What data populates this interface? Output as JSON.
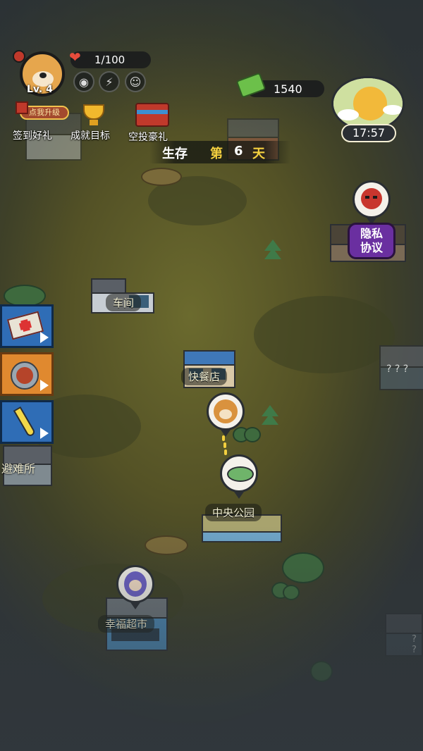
{
  "player": {
    "level": "Lv. 4",
    "health": "1/100",
    "money": "1540",
    "avatar_icon": "dog-avatar"
  },
  "top_menu": [
    {
      "label": "签到好礼",
      "badge": "点我升级",
      "icon": "gift-icon"
    },
    {
      "label": "成就目标",
      "icon": "trophy-icon"
    },
    {
      "label": "空投豪礼",
      "icon": "airdrop-crate-icon"
    }
  ],
  "survival": {
    "prefix": "生存",
    "day_word": "第",
    "day": "6",
    "suffix": "天"
  },
  "clock": {
    "time": "17:57",
    "weather_icon": "sun-icon"
  },
  "privacy": {
    "line1": "隐私",
    "line2": "协议"
  },
  "locations": {
    "garage": "车间",
    "courier": "快餐店",
    "park": "中央公园",
    "supermarket": "幸福超市",
    "shelter": "避难所",
    "unknown_right": "? ? ?",
    "unknown_bottom": "? ?"
  },
  "side_items": [
    {
      "icon": "first-aid-kit-icon"
    },
    {
      "icon": "canned-food-icon"
    },
    {
      "icon": "test-tube-icon"
    }
  ],
  "colors": {
    "accent_gold": "#f4d03f",
    "side_card_blue": "#2f6db6",
    "privacy_purple": "#6a2fa0",
    "money_green": "#6cc04a"
  }
}
